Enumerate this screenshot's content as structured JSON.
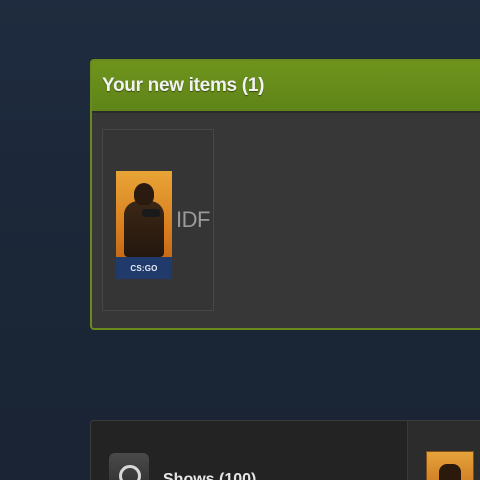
{
  "new_items_panel": {
    "title": "Your new items (1)",
    "items": [
      {
        "name": "IDF",
        "logo_text": "CS:GO"
      }
    ]
  },
  "bottom_section": {
    "label": "Shows (100)",
    "icon": "profile-ring-icon",
    "game_thumb_icon": "csgo-thumbnail"
  },
  "colors": {
    "header_green": "#6f941d",
    "panel_border": "#6b8a1e",
    "panel_bg": "#373737",
    "page_bg": "#1f2c3f"
  }
}
